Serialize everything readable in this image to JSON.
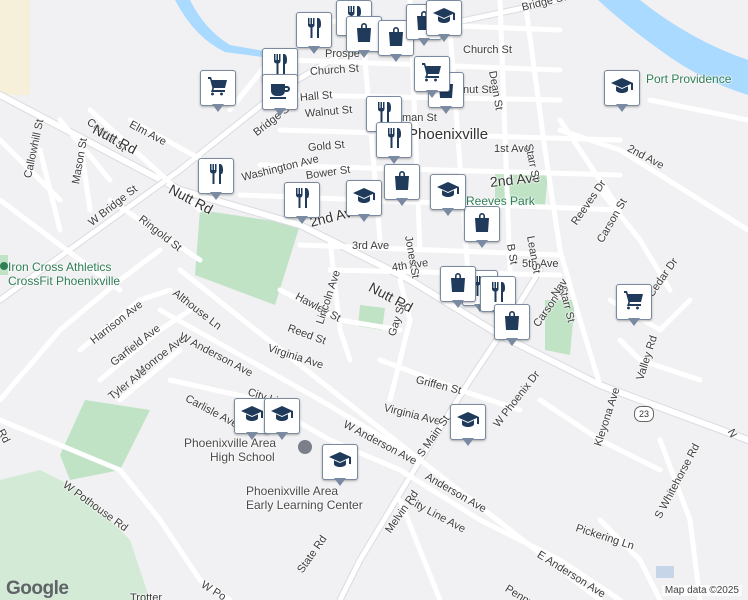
{
  "streets": [
    {
      "id": "bridge-st-top",
      "text": "Bridge St"
    },
    {
      "id": "church-st-east",
      "text": "Church St"
    },
    {
      "id": "church-st-west",
      "text": "Church St"
    },
    {
      "id": "prospect",
      "text": "Prospe"
    },
    {
      "id": "dean-st",
      "text": "Dean St"
    },
    {
      "id": "hall-st",
      "text": "Hall St"
    },
    {
      "id": "walnut-st-west",
      "text": "Walnut St"
    },
    {
      "id": "walnut-st-east",
      "text": "nut St"
    },
    {
      "id": "man-st",
      "text": "man St"
    },
    {
      "id": "elm-ave",
      "text": "Elm Ave"
    },
    {
      "id": "center-st",
      "text": "Center St"
    },
    {
      "id": "bridge-st-mid",
      "text": "Bridge St"
    },
    {
      "id": "gold-st",
      "text": "Gold St"
    },
    {
      "id": "washington-ave",
      "text": "Washington Ave"
    },
    {
      "id": "bower-st",
      "text": "Bower St"
    },
    {
      "id": "first-ave",
      "text": "1st Ave"
    },
    {
      "id": "second-ave-east",
      "text": "2nd Ave"
    },
    {
      "id": "second-ave-far",
      "text": "2nd Ave"
    },
    {
      "id": "second-ave-west",
      "text": "2nd Ave"
    },
    {
      "id": "third-ave",
      "text": "3rd Ave"
    },
    {
      "id": "fourth-ave",
      "text": "4th Ave"
    },
    {
      "id": "fifth-ave",
      "text": "5th Ave"
    },
    {
      "id": "jones-st",
      "text": "Jones St"
    },
    {
      "id": "b-st",
      "text": "B St"
    },
    {
      "id": "lean-st",
      "text": "Lean St"
    },
    {
      "id": "starr-st-north",
      "text": "Starr St"
    },
    {
      "id": "starr-st-south",
      "text": "Starr St"
    },
    {
      "id": "carson-st-north",
      "text": "Carson St"
    },
    {
      "id": "carson-st-south",
      "text": "Carson St"
    },
    {
      "id": "reeves-dr",
      "text": "Reeves Dr"
    },
    {
      "id": "cedar-dr",
      "text": "Cedar Dr"
    },
    {
      "id": "nutt-rd-west",
      "text": "Nutt Rd"
    },
    {
      "id": "nutt-rd-mid",
      "text": "Nutt Rd"
    },
    {
      "id": "nutt-rd-east",
      "text": "Nutt Rd"
    },
    {
      "id": "w-bridge-st",
      "text": "W Bridge St"
    },
    {
      "id": "ringold-st",
      "text": "Ringold St"
    },
    {
      "id": "callowhill-st",
      "text": "Callowhill St"
    },
    {
      "id": "mason-st",
      "text": "Mason St"
    },
    {
      "id": "althouse-ln",
      "text": "Althouse Ln"
    },
    {
      "id": "hawley-st",
      "text": "Hawley St"
    },
    {
      "id": "lincoln-ave",
      "text": "Lincoln Ave"
    },
    {
      "id": "reed-st",
      "text": "Reed St"
    },
    {
      "id": "gay-st",
      "text": "Gay St"
    },
    {
      "id": "harrison-ave",
      "text": "Harrison Ave"
    },
    {
      "id": "garfield-ave",
      "text": "Garfield Ave"
    },
    {
      "id": "monroe-ave",
      "text": "Monroe Ave"
    },
    {
      "id": "tyler-ave",
      "text": "Tyler Ave"
    },
    {
      "id": "w-anderson-ave-north",
      "text": "W Anderson Ave"
    },
    {
      "id": "virginia-ave-west",
      "text": "Virginia Ave"
    },
    {
      "id": "carlisle-ave",
      "text": "Carlisle Ave"
    },
    {
      "id": "city-line-north",
      "text": "City Li"
    },
    {
      "id": "griffen-st",
      "text": "Griffen St"
    },
    {
      "id": "virginia-ave-east",
      "text": "Virginia Ave"
    },
    {
      "id": "w-anderson-ave-south",
      "text": "W Anderson Ave"
    },
    {
      "id": "s-main-st",
      "text": "S Main St"
    },
    {
      "id": "w-phoenix-dr",
      "text": "W Phoenix Dr"
    },
    {
      "id": "valley-rd",
      "text": "Valley Rd"
    },
    {
      "id": "kleyona-ave",
      "text": "Kleyona Ave"
    },
    {
      "id": "s-whitehorse-rd",
      "text": "S Whitehorse Rd"
    },
    {
      "id": "anderson-ave",
      "text": "Anderson Ave"
    },
    {
      "id": "city-line-ave",
      "text": "City Line Ave"
    },
    {
      "id": "melvin-rd",
      "text": "Melvin Rd"
    },
    {
      "id": "pickering-ln",
      "text": "Pickering Ln"
    },
    {
      "id": "e-anderson-ave",
      "text": "E Anderson Ave"
    },
    {
      "id": "penny-ln",
      "text": "Penny"
    },
    {
      "id": "w-pothouse-rd",
      "text": "W Pothouse Rd"
    },
    {
      "id": "w-po",
      "text": "W Po"
    },
    {
      "id": "state-rd",
      "text": "State Rd"
    },
    {
      "id": "trotter",
      "text": "Trotter"
    },
    {
      "id": "nav",
      "text": "Nav"
    },
    {
      "id": "rd-edge",
      "text": "Rd"
    },
    {
      "id": "n-edge",
      "text": "N"
    }
  ],
  "places": {
    "town": "Phoenixville",
    "park": "Reeves Park",
    "port_providence": "Port Providence",
    "gym_line1": "Iron Cross Athletics",
    "gym_line2": "CrossFit Phoenixville",
    "high_school_line1": "Phoenixville Area",
    "high_school_line2": "High School",
    "elc_line1": "Phoenixville Area",
    "elc_line2": "Early Learning Center"
  },
  "route_shield": "23",
  "map": {
    "logo": "Google",
    "credit": "Map data ©2025"
  },
  "markers": [
    {
      "type": "restaurant",
      "icon": "fork-knife-icon"
    },
    {
      "type": "restaurant",
      "icon": "fork-knife-icon"
    },
    {
      "type": "restaurant",
      "icon": "fork-knife-icon"
    },
    {
      "type": "restaurant",
      "icon": "fork-knife-icon"
    },
    {
      "type": "restaurant",
      "icon": "fork-knife-icon"
    },
    {
      "type": "restaurant",
      "icon": "fork-knife-icon"
    },
    {
      "type": "restaurant",
      "icon": "fork-knife-icon"
    },
    {
      "type": "restaurant",
      "icon": "fork-knife-icon"
    },
    {
      "type": "restaurant",
      "icon": "fork-knife-icon"
    },
    {
      "type": "shopping",
      "icon": "shopping-bag-icon"
    },
    {
      "type": "shopping",
      "icon": "shopping-bag-icon"
    },
    {
      "type": "shopping",
      "icon": "shopping-bag-icon"
    },
    {
      "type": "shopping",
      "icon": "shopping-bag-icon"
    },
    {
      "type": "shopping",
      "icon": "shopping-bag-icon"
    },
    {
      "type": "shopping",
      "icon": "shopping-bag-icon"
    },
    {
      "type": "shopping",
      "icon": "shopping-bag-icon"
    },
    {
      "type": "shopping",
      "icon": "shopping-bag-icon"
    },
    {
      "type": "grocery",
      "icon": "shopping-cart-icon"
    },
    {
      "type": "grocery",
      "icon": "shopping-cart-icon"
    },
    {
      "type": "grocery",
      "icon": "shopping-cart-icon"
    },
    {
      "type": "cafe",
      "icon": "coffee-cup-icon"
    },
    {
      "type": "school",
      "icon": "graduation-cap-icon"
    },
    {
      "type": "school",
      "icon": "graduation-cap-icon"
    },
    {
      "type": "school",
      "icon": "graduation-cap-icon"
    },
    {
      "type": "school",
      "icon": "graduation-cap-icon"
    },
    {
      "type": "school",
      "icon": "graduation-cap-icon"
    },
    {
      "type": "school",
      "icon": "graduation-cap-icon"
    },
    {
      "type": "school",
      "icon": "graduation-cap-icon"
    },
    {
      "type": "school",
      "icon": "graduation-cap-icon"
    }
  ]
}
